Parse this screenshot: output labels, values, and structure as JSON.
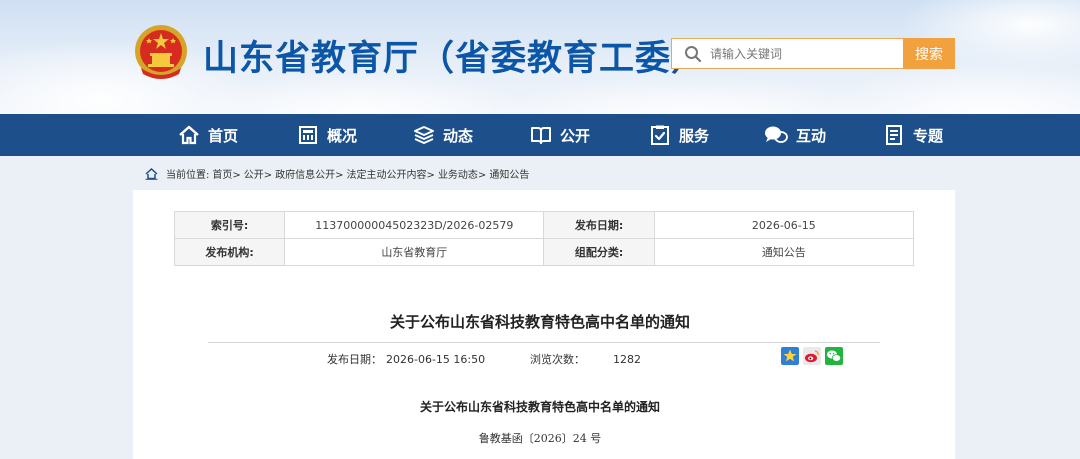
{
  "header": {
    "site_title": "山东省教育厅（省委教育工委）",
    "search_placeholder": "请输入关键词",
    "search_button": "搜索"
  },
  "nav": {
    "items": [
      {
        "label": "首页",
        "icon": "home-icon"
      },
      {
        "label": "概况",
        "icon": "building-icon"
      },
      {
        "label": "动态",
        "icon": "layers-icon"
      },
      {
        "label": "公开",
        "icon": "book-icon"
      },
      {
        "label": "服务",
        "icon": "clipboard-check-icon"
      },
      {
        "label": "互动",
        "icon": "chat-icon"
      },
      {
        "label": "专题",
        "icon": "document-icon"
      }
    ]
  },
  "breadcrumb": {
    "prefix": "当前位置:",
    "items": [
      "首页>",
      "公开>",
      "政府信息公开>",
      "法定主动公开内容>",
      "业务动态>",
      "通知公告"
    ]
  },
  "meta": {
    "index_label": "索引号:",
    "index_value": "11370000004502323D/2026-02579",
    "publish_date_label": "发布日期:",
    "publish_date_value": "2026-06-15",
    "org_label": "发布机构:",
    "org_value": "山东省教育厅",
    "category_label": "组配分类:",
    "category_value": "通知公告"
  },
  "article": {
    "title": "关于公布山东省科技教育特色高中名单的通知",
    "date_label": "发布日期：",
    "date_value": "2026-06-15 16:50",
    "views_label": "浏览次数：",
    "views_value": "1282",
    "body_title": "关于公布山东省科技教育特色高中名单的通知",
    "doc_number": "鲁教基函〔2026〕24 号"
  },
  "colors": {
    "brand_blue": "#0c56a8",
    "nav_bg": "#1d4f8a",
    "accent_orange": "#f1a13d"
  }
}
